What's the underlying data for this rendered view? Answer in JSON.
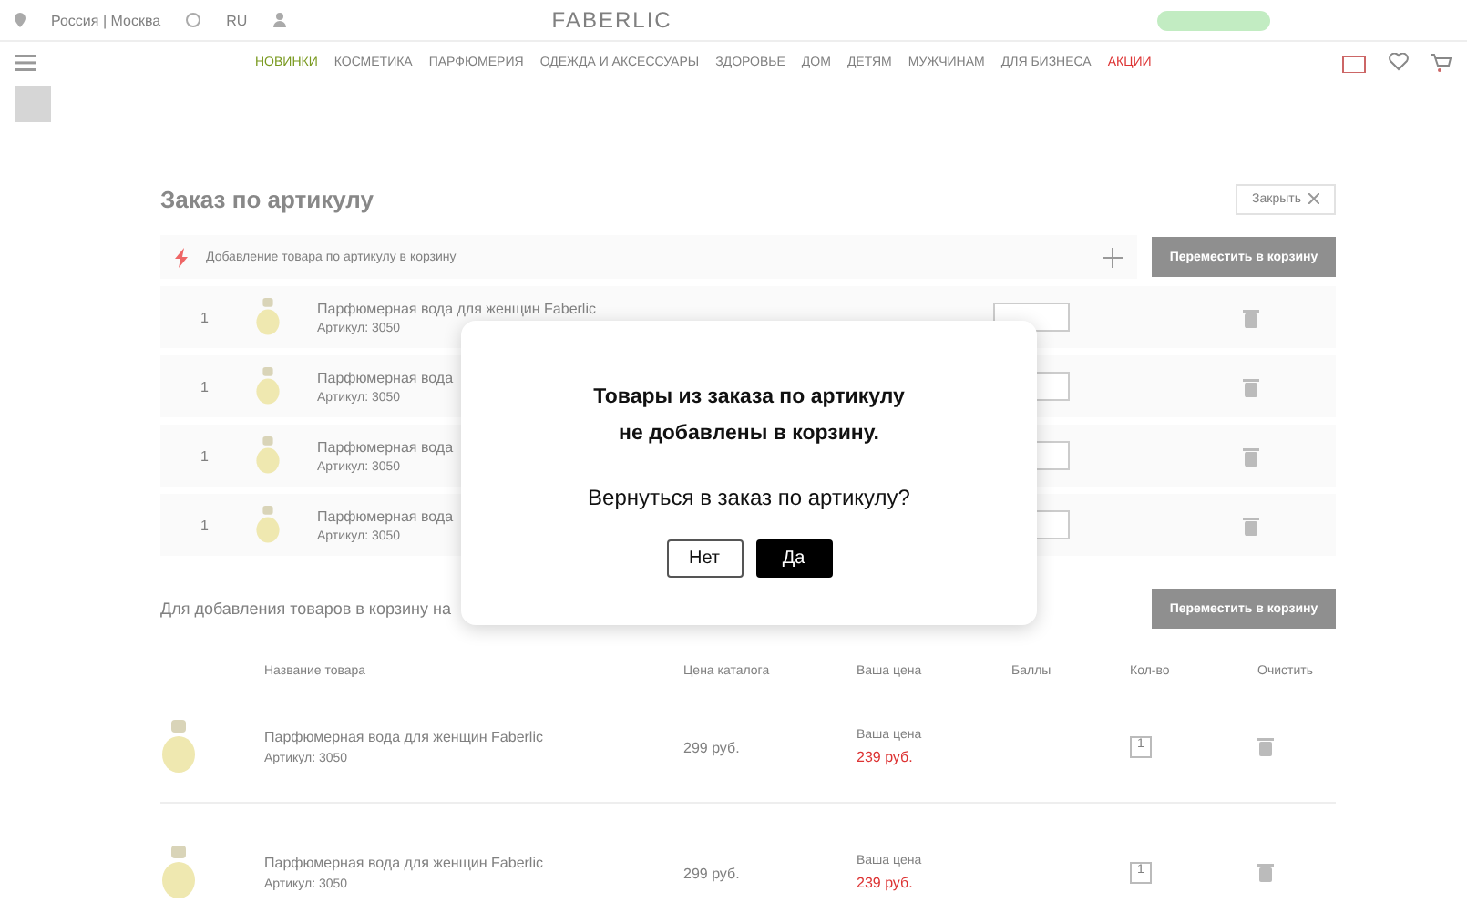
{
  "header": {
    "location": "Россия | Москва",
    "language": "RU",
    "logo": "FABERLIC",
    "nav": [
      {
        "label": "НОВИНКИ",
        "kind": "new"
      },
      {
        "label": "КОСМЕТИКА",
        "kind": "plain"
      },
      {
        "label": "ПАРФЮМЕРИЯ",
        "kind": "plain"
      },
      {
        "label": "ОДЕЖДА И АКСЕССУАРЫ",
        "kind": "plain"
      },
      {
        "label": "ЗДОРОВЬЕ",
        "kind": "plain"
      },
      {
        "label": "ДОМ",
        "kind": "plain"
      },
      {
        "label": "ДЕТЯМ",
        "kind": "plain"
      },
      {
        "label": "МУЖЧИНАМ",
        "kind": "plain"
      },
      {
        "label": "ДЛЯ БИЗНЕСА",
        "kind": "plain"
      },
      {
        "label": "АКЦИИ",
        "kind": "sale"
      }
    ]
  },
  "order": {
    "title": "Заказ по артикулу",
    "close_label": "Закрыть",
    "input_placeholder": "Добавление товара по артикулу в корзину",
    "move_button": "Переместить в корзину",
    "rows": [
      {
        "number": "1",
        "name": "Парфюмерная вода для женщин Faberlic",
        "article_label": "Артикул:",
        "article": "3050"
      },
      {
        "number": "1",
        "name": "Парфюмерная вода",
        "article_label": "Артикул:",
        "article": "3050"
      },
      {
        "number": "1",
        "name": "Парфюмерная вода",
        "article_label": "Артикул:",
        "article": "3050"
      },
      {
        "number": "1",
        "name": "Парфюмерная вода",
        "article_label": "Артикул:",
        "article": "3050"
      }
    ]
  },
  "cart": {
    "note": "Для добавления товаров в корзину на",
    "move_button": "Переместить в корзину",
    "columns": [
      "Название товара",
      "Цена каталога",
      "Ваша цена",
      "Баллы",
      "Кол-во",
      "Очистить"
    ],
    "items": [
      {
        "name": "Парфюмерная вода для женщин Faberlic",
        "article": "Артикул: 3050",
        "catalog_price": "299 руб.",
        "your_price_label": "Ваша цена",
        "your_price": "239 руб.",
        "quantity": "1"
      },
      {
        "name": "Парфюмерная вода для женщин Faberlic",
        "article": "Артикул: 3050",
        "catalog_price": "299 руб.",
        "your_price_label": "Ваша цена",
        "your_price": "239 руб.",
        "quantity": "1"
      }
    ]
  },
  "dialog": {
    "title_lines": [
      "Товары из заказа по артикулу",
      "не добавлены в корзину."
    ],
    "question": "Вернуться в заказ по артикулу?",
    "buttons": [
      {
        "label": "Нет",
        "kind": "secondary"
      },
      {
        "label": "Да",
        "kind": "primary"
      }
    ]
  }
}
